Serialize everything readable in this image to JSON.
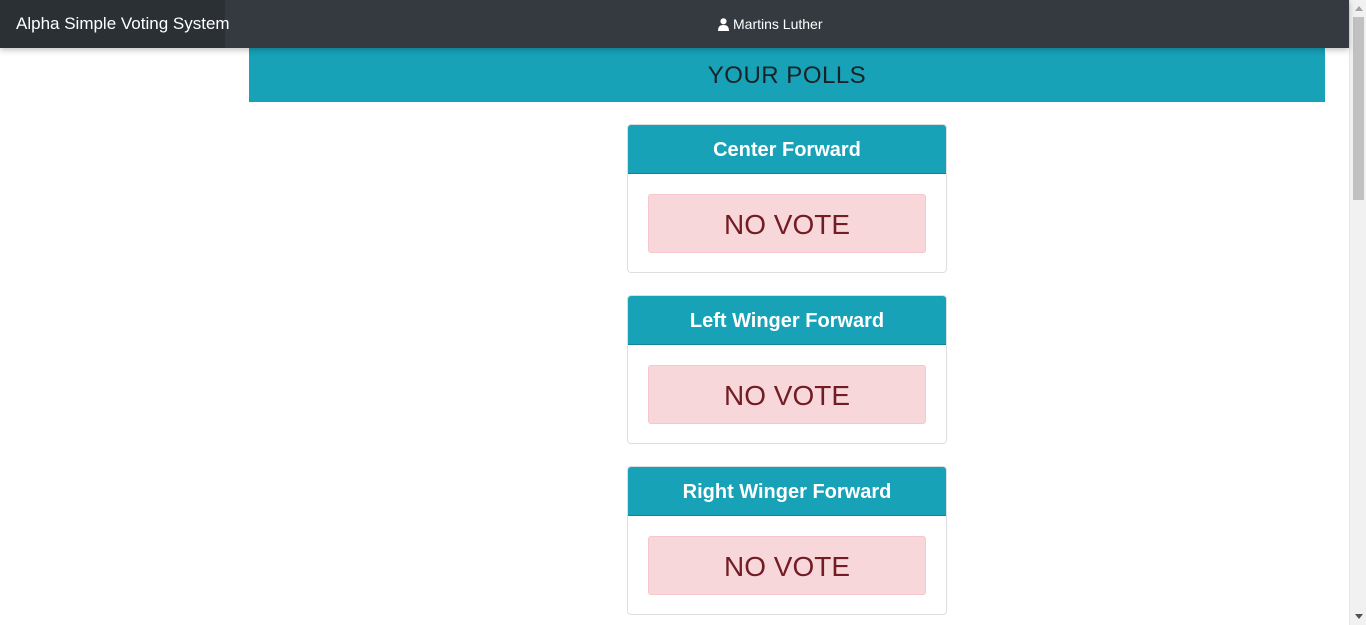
{
  "navbar": {
    "brand": "Alpha Simple Voting System",
    "user_name": "Martins Luther",
    "user_icon": "user-icon"
  },
  "banner": {
    "title": "YOUR POLLS"
  },
  "polls": [
    {
      "position": "Center Forward",
      "status": "NO VOTE"
    },
    {
      "position": "Left Winger Forward",
      "status": "NO VOTE"
    },
    {
      "position": "Right Winger Forward",
      "status": "NO VOTE"
    }
  ],
  "colors": {
    "navbar": "#343a40",
    "brand_bg": "#2b3035",
    "accent": "#17a2b8",
    "alert_bg": "#f8d7da",
    "alert_text": "#721c24"
  }
}
